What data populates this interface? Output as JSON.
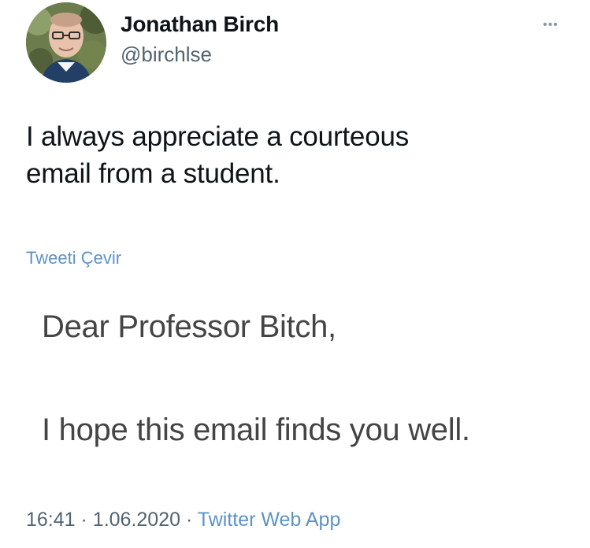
{
  "tweet": {
    "author": {
      "name": "Jonathan Birch",
      "handle": "@birchlse"
    },
    "more_icon": "more-dots-icon",
    "text_line1": "I always appreciate a courteous",
    "text_line2": "email from a student.",
    "translate_label": "Tweeti Çevir",
    "email": {
      "salutation": "Dear Professor Bitch,",
      "body": "I hope this email finds you well."
    },
    "meta": {
      "time": "16:41",
      "separator": "·",
      "date": "1.06.2020",
      "source": "Twitter Web App"
    }
  },
  "colors": {
    "link": "#5b93c7",
    "text": "#0f1419",
    "muted": "#536471"
  }
}
